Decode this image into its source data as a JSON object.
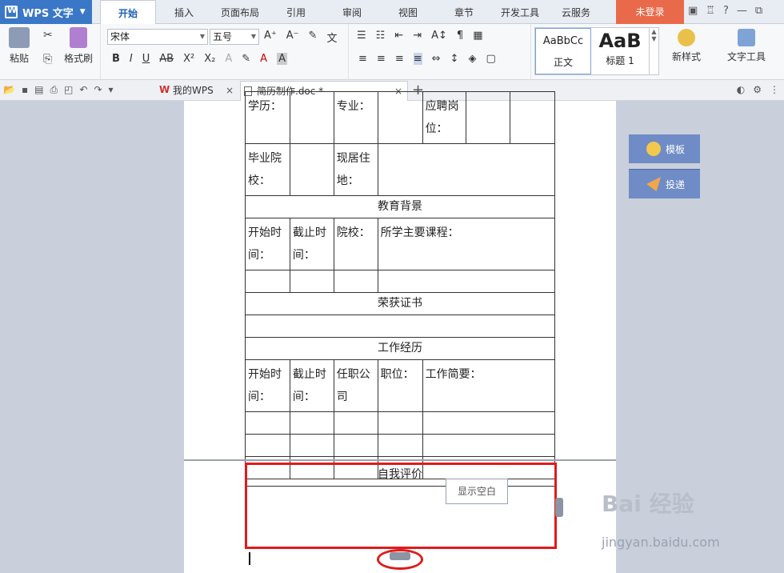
{
  "app": {
    "name": "WPS 文字",
    "login_label": "未登录"
  },
  "menu_tabs": [
    "开始",
    "插入",
    "页面布局",
    "引用",
    "审阅",
    "视图",
    "章节",
    "开发工具",
    "云服务"
  ],
  "ribbon": {
    "paste_label": "粘贴",
    "format_painter_label": "格式刷",
    "font_name": "宋体",
    "font_size": "五号",
    "style_normal_preview": "AaBbCc",
    "style_normal_label": "正文",
    "style_heading_preview": "AaB",
    "style_heading_label": "标题 1",
    "new_style_label": "新样式",
    "text_tools_label": "文字工具"
  },
  "doc_tabs": [
    {
      "label": "我的WPS",
      "active": false
    },
    {
      "label": "简历制作.doc *",
      "active": true
    }
  ],
  "side_buttons": {
    "template": "模板",
    "deliver": "投递"
  },
  "table": {
    "r1": [
      "学历：",
      "",
      "专业：",
      "",
      "应聘岗位：",
      "",
      ""
    ],
    "r2": [
      "毕业院校：",
      "",
      "现居住地：",
      ""
    ],
    "edu_header": "教育背景",
    "edu_cols": [
      "开始时间：",
      "截止时间：",
      "院校：",
      "所学主要课程："
    ],
    "award_header": "荣获证书",
    "work_header": "工作经历",
    "work_cols": [
      "开始时间：",
      "截止时间：",
      "任职公司",
      "职位：",
      "工作简要："
    ]
  },
  "self_eval_header": "自我评价",
  "show_blank_tooltip": "显示空白",
  "watermark": {
    "brand": "Bai 经验",
    "url": "jingyan.baidu.com"
  },
  "colors": {
    "accent": "#3a77c7",
    "highlight": "#e21a1a",
    "login": "#e96a4a",
    "side_button": "#6f8cc6"
  }
}
